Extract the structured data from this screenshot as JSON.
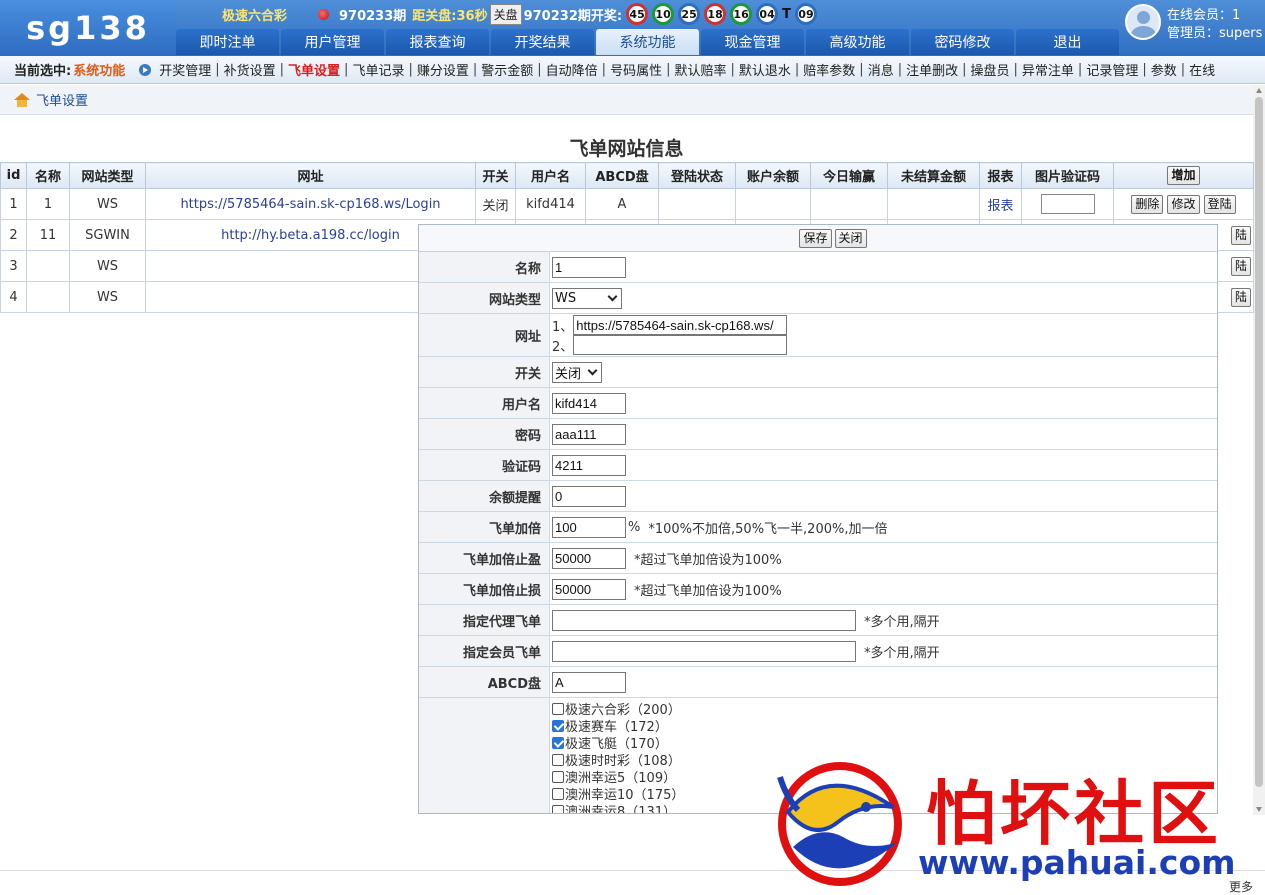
{
  "header": {
    "logo": "sg138",
    "game": "极速六合彩",
    "current_period": "970233期",
    "countdown": "距关盘:36秒",
    "close_button": "关盘",
    "last_period": "970232期开奖:",
    "balls": [
      {
        "num": "45",
        "color": "#cc3333"
      },
      {
        "num": "10",
        "color": "#1a9a3a"
      },
      {
        "num": "25",
        "color": "#2e6cc0"
      },
      {
        "num": "18",
        "color": "#cc3333"
      },
      {
        "num": "16",
        "color": "#1a9a3a"
      },
      {
        "num": "04",
        "color": "#2e6cc0"
      }
    ],
    "special_label": "T",
    "special_ball": {
      "num": "09",
      "color": "#2e6cc0"
    },
    "tabs": [
      "即时注单",
      "用户管理",
      "报表查询",
      "开奖结果",
      "系统功能",
      "现金管理",
      "高级功能",
      "密码修改",
      "退出"
    ],
    "active_tab": 4,
    "online_label": "在线会员：1",
    "admin_label": "管理员：supers"
  },
  "subnav": {
    "current_label": "当前选中:",
    "current_value": "系统功能",
    "links": [
      "开奖管理",
      "补货设置",
      "飞单设置",
      "飞单记录",
      "赚分设置",
      "警示金额",
      "自动降倍",
      "号码属性",
      "默认赔率",
      "默认退水",
      "赔率参数",
      "消息",
      "注单删改",
      "操盘员",
      "异常注单",
      "记录管理",
      "参数",
      "在线"
    ],
    "active_link": 2
  },
  "breadcrumb": "飞单设置",
  "page_title": "飞单网站信息",
  "table": {
    "headers": [
      "id",
      "名称",
      "网站类型",
      "网址",
      "开关",
      "用户名",
      "ABCD盘",
      "登陆状态",
      "账户余额",
      "今日输赢",
      "未结算金额",
      "报表",
      "图片验证码"
    ],
    "add_button": "增加",
    "rows": [
      {
        "id": "1",
        "name": "1",
        "type": "WS",
        "url": "https://5785464-sain.sk-cp168.ws/Login",
        "switch": "关闭",
        "user": "kifd414",
        "abcd": "A",
        "report": "报表"
      },
      {
        "id": "2",
        "name": "11",
        "type": "SGWIN",
        "url": "http://hy.beta.a198.cc/login",
        "switch": "",
        "user": "",
        "abcd": "",
        "report": ""
      },
      {
        "id": "3",
        "name": "",
        "type": "WS",
        "url": "",
        "switch": "",
        "user": "",
        "abcd": "",
        "report": ""
      },
      {
        "id": "4",
        "name": "",
        "type": "WS",
        "url": "",
        "switch": "",
        "user": "",
        "abcd": "",
        "report": ""
      }
    ],
    "delete_button": "删除",
    "edit_button": "修改",
    "login_button": "登陆",
    "login_button_partial": "陆"
  },
  "modal": {
    "save_button": "保存",
    "close_button": "关闭",
    "name_label": "名称",
    "name_value": "1",
    "type_label": "网站类型",
    "type_value": "WS",
    "url_label": "网址",
    "url1_prefix": "1、",
    "url1_value": "https://5785464-sain.sk-cp168.ws/",
    "url2_prefix": "2、",
    "url2_value": "",
    "switch_label": "开关",
    "switch_value": "关闭",
    "user_label": "用户名",
    "user_value": "kifd414",
    "pwd_label": "密码",
    "pwd_value": "aaa111",
    "captcha_label": "验证码",
    "captcha_value": "4211",
    "balance_label": "余额提醒",
    "balance_value": "0",
    "multiplier_label": "飞单加倍",
    "multiplier_value": "100",
    "multiplier_unit": "%",
    "multiplier_note": "*100%不加倍,50%飞一半,200%,加一倍",
    "stop_profit_label": "飞单加倍止盈",
    "stop_profit_value": "50000",
    "stop_profit_note": "*超过飞单加倍设为100%",
    "stop_loss_label": "飞单加倍止损",
    "stop_loss_value": "50000",
    "stop_loss_note": "*超过飞单加倍设为100%",
    "agent_label": "指定代理飞单",
    "agent_value": "",
    "agent_note": "*多个用,隔开",
    "member_label": "指定会员飞单",
    "member_value": "",
    "member_note": "*多个用,隔开",
    "abcd_label": "ABCD盘",
    "abcd_value": "A",
    "games": [
      {
        "label": "极速六合彩（200）",
        "checked": false
      },
      {
        "label": "极速赛车（172）",
        "checked": true
      },
      {
        "label": "极速飞艇（170）",
        "checked": true
      },
      {
        "label": "极速时时彩（108）",
        "checked": false
      },
      {
        "label": "澳洲幸运5（109）",
        "checked": false
      },
      {
        "label": "澳洲幸运10（175）",
        "checked": false
      },
      {
        "label": "澳洲幸运8（131）",
        "checked": false
      }
    ]
  },
  "watermark": {
    "title": "怕坏社区",
    "site": "www.pahuai.com"
  },
  "footer_more": "更多"
}
